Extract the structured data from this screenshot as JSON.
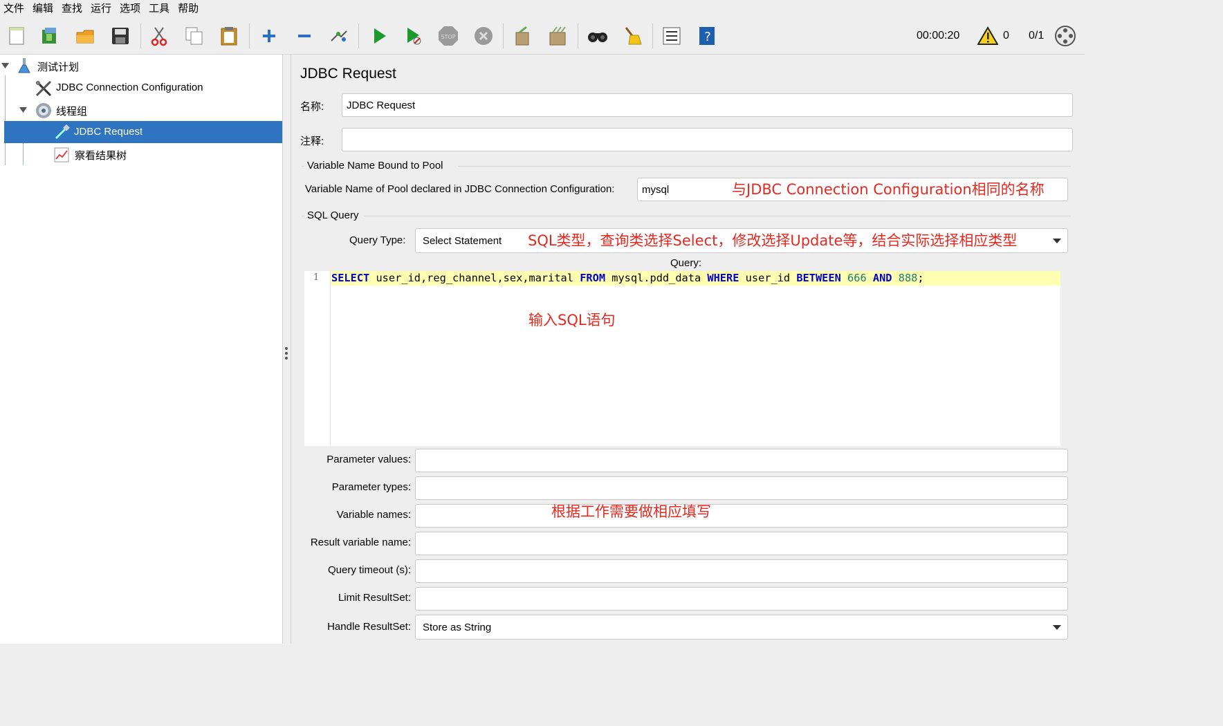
{
  "menu": [
    "文件",
    "编辑",
    "查找",
    "运行",
    "选项",
    "工具",
    "帮助"
  ],
  "toolbar": {
    "timer": "00:00:20",
    "warnings": "0",
    "threads": "0/1",
    "icons": [
      "new-icon",
      "templates-icon",
      "open-icon",
      "save-icon",
      "cut-icon",
      "copy-icon",
      "paste-icon",
      "expand-icon",
      "collapse-icon",
      "toggle-icon",
      "start-icon",
      "start-no-pause-icon",
      "stop-icon",
      "shutdown-icon",
      "clear-icon",
      "clear-all-icon",
      "search-icon",
      "reset-search-icon",
      "function-helper-icon",
      "help-icon"
    ]
  },
  "tree": {
    "items": [
      {
        "label": "测试计划",
        "icon": "test-plan-icon"
      },
      {
        "label": "JDBC Connection Configuration",
        "icon": "config-tools-icon"
      },
      {
        "label": "线程组",
        "icon": "gear-icon"
      },
      {
        "label": "JDBC Request",
        "icon": "sampler-pipette-icon",
        "selected": true
      },
      {
        "label": "察看结果树",
        "icon": "listener-graph-icon"
      }
    ]
  },
  "panel": {
    "title": "JDBC Request",
    "name_label": "名称:",
    "name_value": "JDBC Request",
    "comment_label": "注释:",
    "comment_value": "",
    "pool_section": "Variable Name Bound to Pool",
    "pool_label": "Variable Name of Pool declared in JDBC Connection Configuration:",
    "pool_value": "mysql",
    "sql_section": "SQL Query",
    "query_type_label": "Query Type:",
    "query_type_value": "Select Statement",
    "query_label": "Query:",
    "line_number": "1",
    "query_tokens": [
      {
        "t": "SELECT",
        "k": "kw"
      },
      {
        "t": " user_id,reg_channel,sex,marital ",
        "k": ""
      },
      {
        "t": "FROM",
        "k": "kw"
      },
      {
        "t": " mysql.pdd_data ",
        "k": ""
      },
      {
        "t": "WHERE",
        "k": "kw"
      },
      {
        "t": " user_id ",
        "k": ""
      },
      {
        "t": "BETWEEN",
        "k": "kw"
      },
      {
        "t": " ",
        "k": ""
      },
      {
        "t": "666",
        "k": "num"
      },
      {
        "t": " ",
        "k": ""
      },
      {
        "t": "AND",
        "k": "kw"
      },
      {
        "t": " ",
        "k": ""
      },
      {
        "t": "888",
        "k": "num"
      },
      {
        "t": ";",
        "k": ""
      }
    ],
    "param_values_label": "Parameter values:",
    "param_types_label": "Parameter types:",
    "variable_names_label": "Variable names:",
    "result_var_label": "Result variable name:",
    "query_timeout_label": "Query timeout (s):",
    "limit_resultset_label": "Limit ResultSet:",
    "handle_resultset_label": "Handle ResultSet:",
    "handle_resultset_value": "Store as String"
  },
  "annotations": {
    "pool_note": "与JDBC Connection Configuration相同的名称",
    "query_type_note": "SQL类型，查询类选择Select，修改选择Update等，结合实际选择相应类型",
    "sql_note": "输入SQL语句",
    "params_note": "根据工作需要做相应填写"
  },
  "colors": {
    "selection": "#2f74c0",
    "annotation": "#e8281e",
    "keyword": "#0000c8",
    "number": "#1a7a7a",
    "current_line": "#ffffb2"
  }
}
